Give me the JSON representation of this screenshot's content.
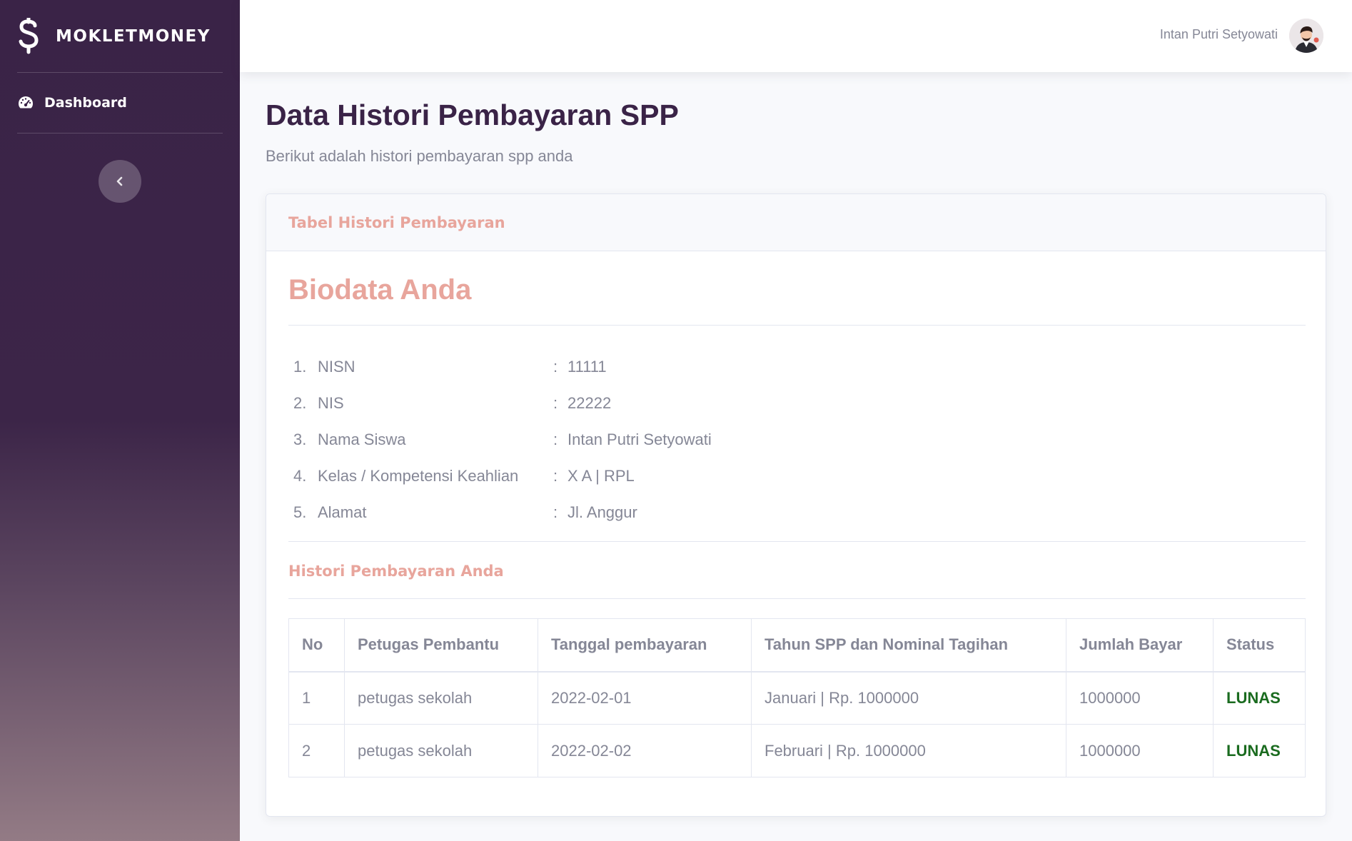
{
  "brand": {
    "name": "MOKLETMONEY",
    "icon": "dollar-icon"
  },
  "sidebar": {
    "items": [
      {
        "label": "Dashboard",
        "icon": "tachometer-icon"
      }
    ],
    "toggle_icon": "chevron-left-icon"
  },
  "topbar": {
    "user_name": "Intan Putri Setyowati"
  },
  "page": {
    "title": "Data Histori Pembayaran SPP",
    "subtitle": "Berikut adalah histori pembayaran spp anda"
  },
  "card": {
    "header": "Tabel Histori Pembayaran",
    "biodata_title": "Biodata Anda",
    "biodata": [
      {
        "no": "1.",
        "label": "NISN",
        "colon": ":",
        "value": "11111"
      },
      {
        "no": "2.",
        "label": "NIS",
        "colon": ":",
        "value": "22222"
      },
      {
        "no": "3.",
        "label": "Nama Siswa",
        "colon": ":",
        "value": "Intan Putri Setyowati"
      },
      {
        "no": "4.",
        "label": "Kelas / Kompetensi Keahlian",
        "colon": ":",
        "value": "X A | RPL"
      },
      {
        "no": "5.",
        "label": "Alamat",
        "colon": ":",
        "value": "Jl. Anggur"
      }
    ],
    "histori_title": "Histori Pembayaran Anda",
    "table": {
      "headers": [
        "No",
        "Petugas Pembantu",
        "Tanggal pembayaran",
        "Tahun SPP dan Nominal Tagihan",
        "Jumlah Bayar",
        "Status"
      ],
      "rows": [
        [
          "1",
          "petugas sekolah",
          "2022-02-01",
          "Januari | Rp. 1000000",
          "1000000",
          "LUNAS"
        ],
        [
          "2",
          "petugas sekolah",
          "2022-02-02",
          "Februari | Rp. 1000000",
          "1000000",
          "LUNAS"
        ]
      ]
    }
  },
  "colors": {
    "sidebar_top": "#3a2347",
    "sidebar_bottom": "#937b85",
    "accent": "#e8a59c",
    "title": "#3a2347",
    "status_paid": "#1a6b1f"
  }
}
